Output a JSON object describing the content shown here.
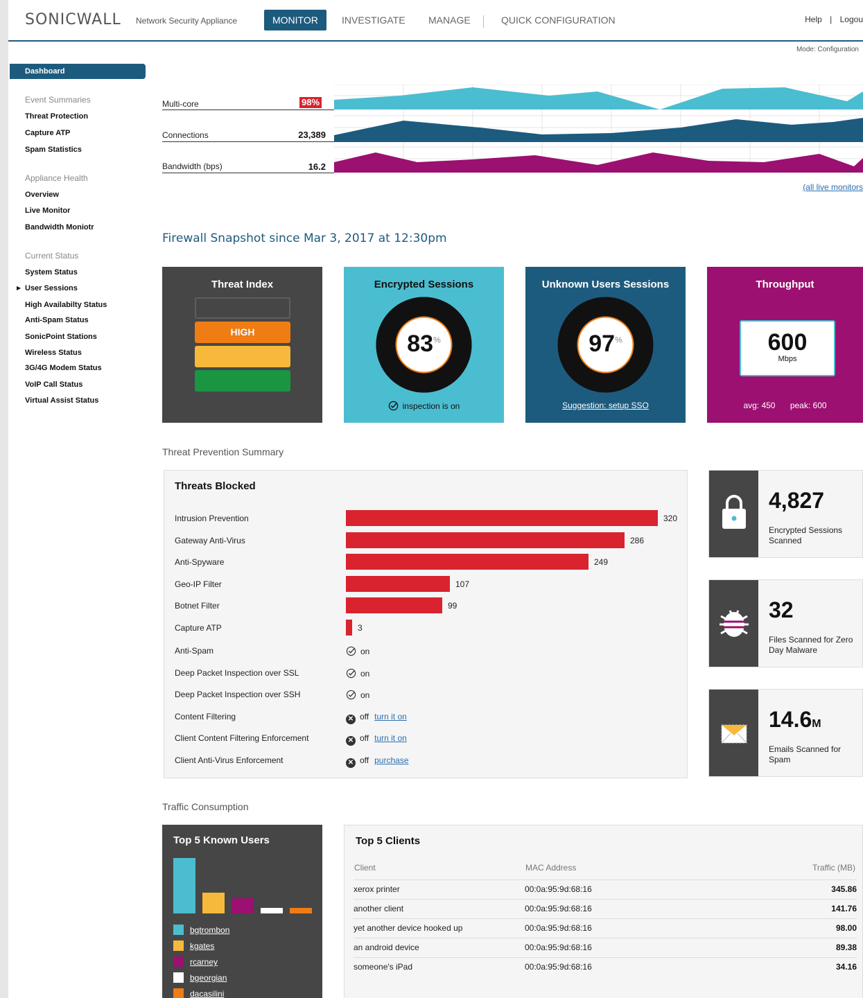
{
  "header": {
    "brand": "SONICWALL",
    "tagline": "Network Security Appliance",
    "nav": [
      "MONITOR",
      "INVESTIGATE",
      "MANAGE",
      "QUICK CONFIGURATION"
    ],
    "help": "Help",
    "sep": "|",
    "logout": "Logou",
    "mode": "Mode: Configuration"
  },
  "sidebar": {
    "dashboard": "Dashboard",
    "groups": [
      {
        "title": "Event Summaries",
        "items": [
          "Threat Protection",
          "Capture ATP",
          "Spam Statistics"
        ]
      },
      {
        "title": "Appliance Health",
        "items": [
          "Overview",
          "Live Monitor",
          "Bandwidth Moniotr"
        ]
      },
      {
        "title": "Current Status",
        "items": [
          "System Status",
          "User Sessions",
          "High Availabilty Status",
          "Anti-Spam Status",
          "SonicPoint Stations",
          "Wireless Status",
          "3G/4G Modem Status",
          "VoIP Call Status",
          "Virtual Assist Status"
        ]
      }
    ]
  },
  "monitors": {
    "rows": [
      {
        "label": "Multi-core",
        "value": "98%",
        "color": "#4bbdd0"
      },
      {
        "label": "Connections",
        "value": "23,389",
        "color": "#1d5b7e"
      },
      {
        "label": "Bandwidth (bps)",
        "value": "16.2",
        "color": "#9b1070"
      }
    ],
    "all_link": "(all live monitors"
  },
  "snapshot": {
    "title": "Firewall Snapshot since Mar 3, 2017 at 12:30pm",
    "threat_index": {
      "title": "Threat Index",
      "level": "HIGH"
    },
    "encrypted": {
      "title": "Encrypted Sessions",
      "value": "83",
      "percent": 83,
      "unit": "%",
      "footer": "inspection is on"
    },
    "unknown": {
      "title": "Unknown Users Sessions",
      "value": "97",
      "percent": 97,
      "unit": "%",
      "footer": "Suggestion: setup SSO"
    },
    "throughput": {
      "title": "Throughput",
      "value": "600",
      "unit": "Mbps",
      "avg": "avg: 450",
      "peak": "peak: 600"
    }
  },
  "threats": {
    "section": "Threat Prevention Summary",
    "title": "Threats Blocked",
    "bars": [
      {
        "label": "Intrusion Prevention",
        "value": 320
      },
      {
        "label": "Gateway Anti-Virus",
        "value": 286
      },
      {
        "label": "Anti-Spyware",
        "value": 249
      },
      {
        "label": "Geo-IP Filter",
        "value": 107
      },
      {
        "label": "Botnet Filter",
        "value": 99
      },
      {
        "label": "Capture ATP",
        "value": 3
      }
    ],
    "statuses": [
      {
        "label": "Anti-Spam",
        "state": "on",
        "link": ""
      },
      {
        "label": "Deep Packet Inspection over SSL",
        "state": "on",
        "link": ""
      },
      {
        "label": "Deep Packet Inspection over SSH",
        "state": "on",
        "link": ""
      },
      {
        "label": "Content Filtering",
        "state": "off",
        "link": "turn it on"
      },
      {
        "label": "Client Content Filtering Enforcement",
        "state": "off",
        "link": "turn it on"
      },
      {
        "label": "Client Anti-Virus Enforcement",
        "state": "off",
        "link": "purchase"
      }
    ]
  },
  "stats": [
    {
      "value": "4,827",
      "desc": "Encrypted Sessions Scanned",
      "icon": "lock-icon"
    },
    {
      "value": "32",
      "desc": "Files Scanned for Zero Day Malware",
      "icon": "bug-icon"
    },
    {
      "value": "14.6",
      "suffix": "M",
      "desc": "Emails Scanned for Spam",
      "icon": "envelope-icon"
    }
  ],
  "traffic": {
    "section": "Traffic Consumption",
    "known_title": "Top 5 Known Users",
    "users": [
      {
        "name": "bgtrombon",
        "color": "#4bbdd0",
        "share": 1.0
      },
      {
        "name": "kgates",
        "color": "#f6b93b",
        "share": 0.37
      },
      {
        "name": "rcarney",
        "color": "#9b1070",
        "share": 0.28
      },
      {
        "name": "bgeorgian",
        "color": "#ffffff",
        "share": 0.1
      },
      {
        "name": "dacasilini",
        "color": "#f07c14",
        "share": 0.1
      }
    ],
    "clients_title": "Top 5 Clients",
    "headers": {
      "client": "Client",
      "mac": "MAC Address",
      "traffic": "Traffic (MB)"
    },
    "clients": [
      {
        "client": "xerox printer",
        "mac": "00:0a:95:9d:68:16",
        "traffic": "345.86"
      },
      {
        "client": "another client",
        "mac": "00:0a:95:9d:68:16",
        "traffic": "141.76"
      },
      {
        "client": "yet another device hooked up",
        "mac": "00:0a:95:9d:68:16",
        "traffic": "98.00"
      },
      {
        "client": "an android device",
        "mac": "00:0a:95:9d:68:16",
        "traffic": "89.38"
      },
      {
        "client": "someone's iPad",
        "mac": "00:0a:95:9d:68:16",
        "traffic": "34.16"
      }
    ]
  }
}
